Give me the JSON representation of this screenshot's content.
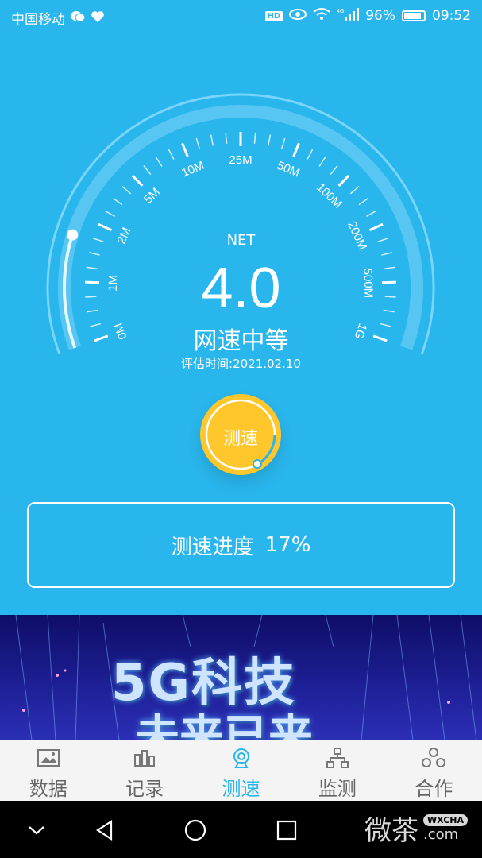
{
  "status_bar": {
    "carrier": "中国移动",
    "network": "4G",
    "battery": "96%",
    "battery_level": 0.96,
    "time": "09:52"
  },
  "gauge": {
    "net_label": "NET",
    "value": "4.0",
    "rating": "网速中等",
    "eval_date": "评估时间:2021.02.10",
    "scale_labels": [
      "0M",
      "1M",
      "2M",
      "5M",
      "10M",
      "25M",
      "50M",
      "100M",
      "200M",
      "500M",
      "1G"
    ],
    "progress_fraction": 0.17
  },
  "test_button": {
    "label": "测速"
  },
  "progress": {
    "label": "测速进度",
    "value": "17%"
  },
  "banner": {
    "line1": "5G科技",
    "line2": "未来已来"
  },
  "tabbar": {
    "tabs": [
      {
        "label": "数据",
        "icon": "image-icon",
        "active": false
      },
      {
        "label": "记录",
        "icon": "bar-chart-icon",
        "active": false
      },
      {
        "label": "测速",
        "icon": "webcam-icon",
        "active": true
      },
      {
        "label": "监测",
        "icon": "network-icon",
        "active": false
      },
      {
        "label": "合作",
        "icon": "people-icon",
        "active": false
      }
    ]
  },
  "watermark": {
    "text": "微茶",
    "badge": "WXCHA",
    "suffix": ".com"
  },
  "colors": {
    "primary": "#29B6EC",
    "accent": "#FFC72C",
    "tab_inactive": "#666666"
  }
}
